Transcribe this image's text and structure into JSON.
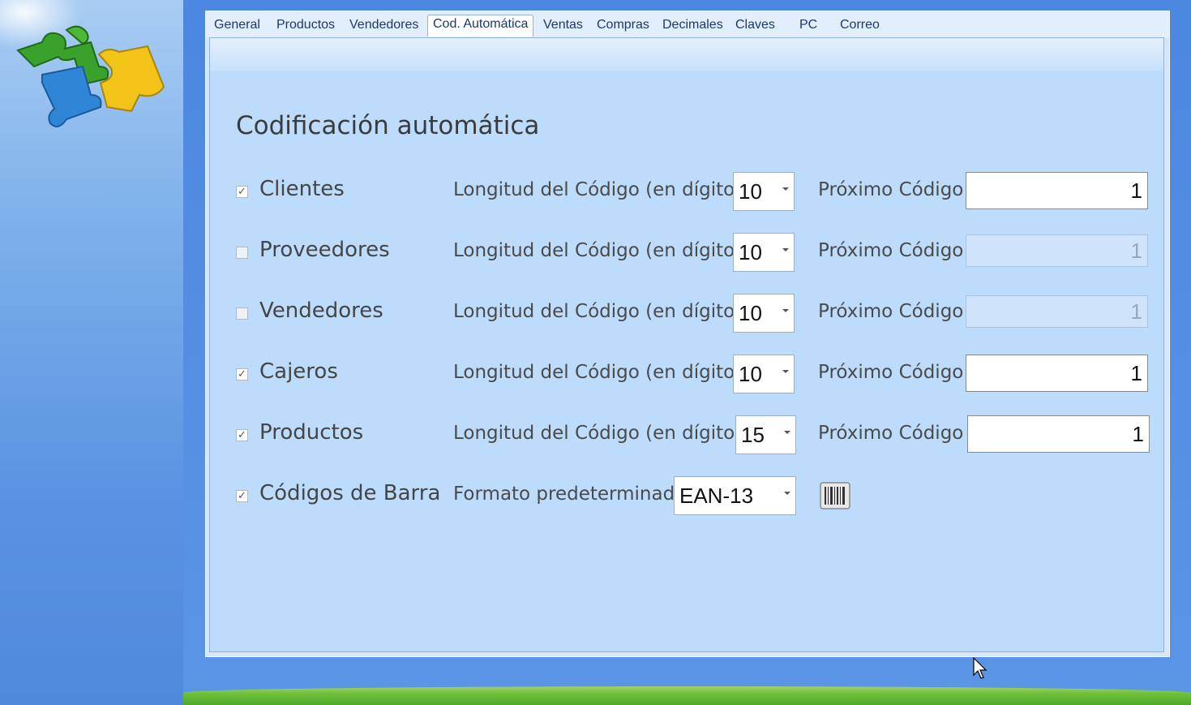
{
  "tabs": [
    {
      "label": "General"
    },
    {
      "label": "Productos"
    },
    {
      "label": "Vendedores"
    },
    {
      "label": "Cod. Automática",
      "active": true
    },
    {
      "label": "Ventas"
    },
    {
      "label": "Compras"
    },
    {
      "label": "Decimales"
    },
    {
      "label": "Claves"
    },
    {
      "label": "PC"
    },
    {
      "label": "Correo"
    }
  ],
  "page": {
    "title": "Codificación automática"
  },
  "rows": [
    {
      "label": "Clientes",
      "checked": true,
      "length_label": "Longitud del Código (en dígitos)",
      "length": "10",
      "next_label": "Próximo Código",
      "next": "1",
      "next_enabled": true
    },
    {
      "label": "Proveedores",
      "checked": false,
      "length_label": "Longitud del Código (en dígitos)",
      "length": "10",
      "next_label": "Próximo Código",
      "next": "1",
      "next_enabled": false
    },
    {
      "label": "Vendedores",
      "checked": false,
      "length_label": "Longitud del Código (en dígitos)",
      "length": "10",
      "next_label": "Próximo Código",
      "next": "1",
      "next_enabled": false
    },
    {
      "label": "Cajeros",
      "checked": true,
      "length_label": "Longitud del Código (en dígitos)",
      "length": "10",
      "next_label": "Próximo Código",
      "next": "1",
      "next_enabled": true
    },
    {
      "label": "Productos",
      "checked": true,
      "length_label": "Longitud del Código (en dígitos)",
      "length": "15",
      "next_label": "Próximo Código",
      "next": "1",
      "next_enabled": true
    }
  ],
  "barcode": {
    "label": "Códigos de Barra",
    "checked": true,
    "format_label": "Formato predeterminado",
    "format": "EAN-13",
    "button_icon": "barcode-icon"
  },
  "icons": {
    "logo": "puzzle-logo-icon",
    "checkmark": "✓",
    "cursor": "mouse-pointer-icon"
  }
}
